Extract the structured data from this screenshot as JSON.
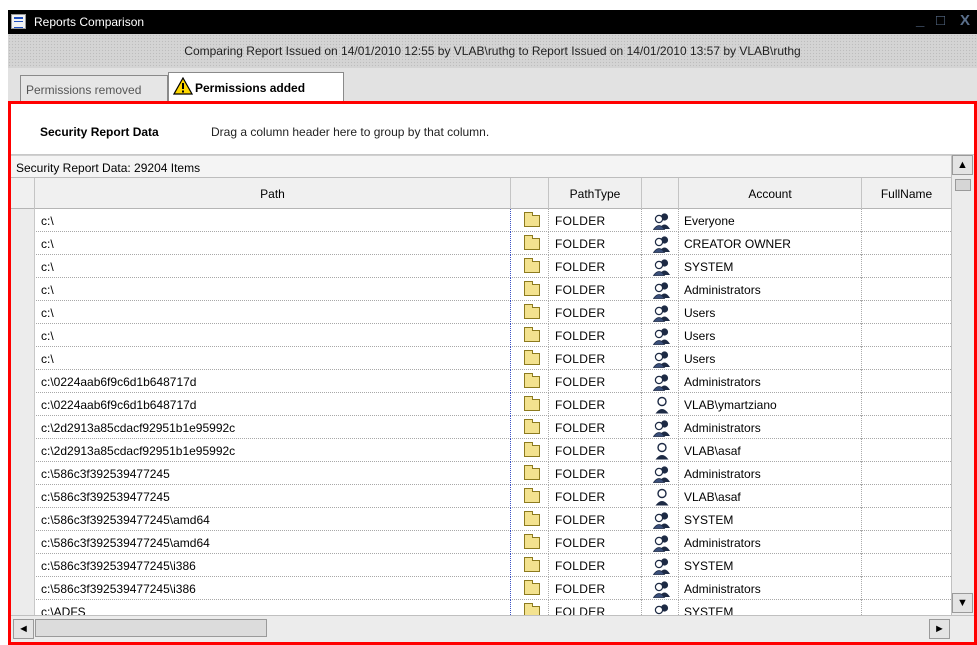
{
  "window": {
    "title": "Reports Comparison",
    "minimize_glyph": "_",
    "maximize_glyph": "□",
    "close_glyph": "X",
    "subtitle": "Comparing Report Issued on 14/01/2010 12:55 by VLAB\\ruthg to Report Issued on 14/01/2010 13:57 by VLAB\\ruthg"
  },
  "tabs": [
    {
      "label": "Permissions removed",
      "active": false
    },
    {
      "label": "Permissions added",
      "active": true,
      "icon": "warning-icon"
    }
  ],
  "group_panel": {
    "title": "Security Report Data",
    "hint": "Drag a column header here to group by that column."
  },
  "grid": {
    "count_text": "Security Report Data: 29204 Items",
    "columns": {
      "path": "Path",
      "path_type": "PathType",
      "account": "Account",
      "full_name": "FullName"
    },
    "rows": [
      {
        "path": "c:\\",
        "type": "FOLDER",
        "account": "Everyone",
        "icon": "group-icon"
      },
      {
        "path": "c:\\",
        "type": "FOLDER",
        "account": "CREATOR OWNER",
        "icon": "group-icon"
      },
      {
        "path": "c:\\",
        "type": "FOLDER",
        "account": "SYSTEM",
        "icon": "group-icon"
      },
      {
        "path": "c:\\",
        "type": "FOLDER",
        "account": "Administrators",
        "icon": "group-icon"
      },
      {
        "path": "c:\\",
        "type": "FOLDER",
        "account": "Users",
        "icon": "group-icon"
      },
      {
        "path": "c:\\",
        "type": "FOLDER",
        "account": "Users",
        "icon": "group-icon"
      },
      {
        "path": "c:\\",
        "type": "FOLDER",
        "account": "Users",
        "icon": "group-icon"
      },
      {
        "path": "c:\\0224aab6f9c6d1b648717d",
        "type": "FOLDER",
        "account": "Administrators",
        "icon": "group-icon"
      },
      {
        "path": "c:\\0224aab6f9c6d1b648717d",
        "type": "FOLDER",
        "account": "VLAB\\ymartziano",
        "icon": "user-icon"
      },
      {
        "path": "c:\\2d2913a85cdacf92951b1e95992c",
        "type": "FOLDER",
        "account": "Administrators",
        "icon": "group-icon"
      },
      {
        "path": "c:\\2d2913a85cdacf92951b1e95992c",
        "type": "FOLDER",
        "account": "VLAB\\asaf",
        "icon": "user-icon"
      },
      {
        "path": "c:\\586c3f392539477245",
        "type": "FOLDER",
        "account": "Administrators",
        "icon": "group-icon"
      },
      {
        "path": "c:\\586c3f392539477245",
        "type": "FOLDER",
        "account": "VLAB\\asaf",
        "icon": "user-icon"
      },
      {
        "path": "c:\\586c3f392539477245\\amd64",
        "type": "FOLDER",
        "account": "SYSTEM",
        "icon": "group-icon"
      },
      {
        "path": "c:\\586c3f392539477245\\amd64",
        "type": "FOLDER",
        "account": "Administrators",
        "icon": "group-icon"
      },
      {
        "path": "c:\\586c3f392539477245\\i386",
        "type": "FOLDER",
        "account": "SYSTEM",
        "icon": "group-icon"
      },
      {
        "path": "c:\\586c3f392539477245\\i386",
        "type": "FOLDER",
        "account": "Administrators",
        "icon": "group-icon"
      },
      {
        "path": "c:\\ADFS",
        "type": "FOLDER",
        "account": "SYSTEM",
        "icon": "group-icon"
      }
    ]
  },
  "scrollbar": {
    "up_glyph": "▲",
    "down_glyph": "▼",
    "left_glyph": "◄",
    "right_glyph": "►"
  },
  "colors": {
    "frame_border": "#ff0000",
    "titlebar": "#000000"
  }
}
